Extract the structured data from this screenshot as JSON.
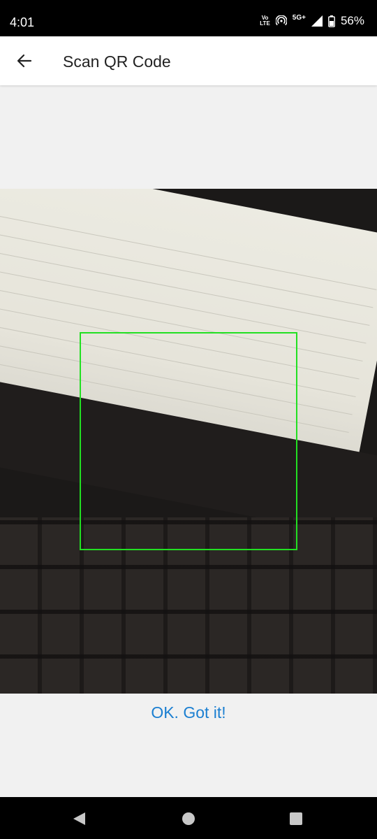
{
  "status_bar": {
    "time": "4:01",
    "volte_top": "Vo",
    "volte_bottom": "LTE",
    "network": "5G+",
    "battery": "56%"
  },
  "app_bar": {
    "back_icon": "arrow-left-icon",
    "title": "Scan QR Code"
  },
  "camera": {
    "frame_color": "#22e022"
  },
  "actions": {
    "ok_label": "OK. Got it!",
    "ok_color": "#1b7fd1"
  },
  "nav": {
    "back_icon": "triangle-back-icon",
    "home_icon": "circle-home-icon",
    "recents_icon": "square-recents-icon"
  }
}
